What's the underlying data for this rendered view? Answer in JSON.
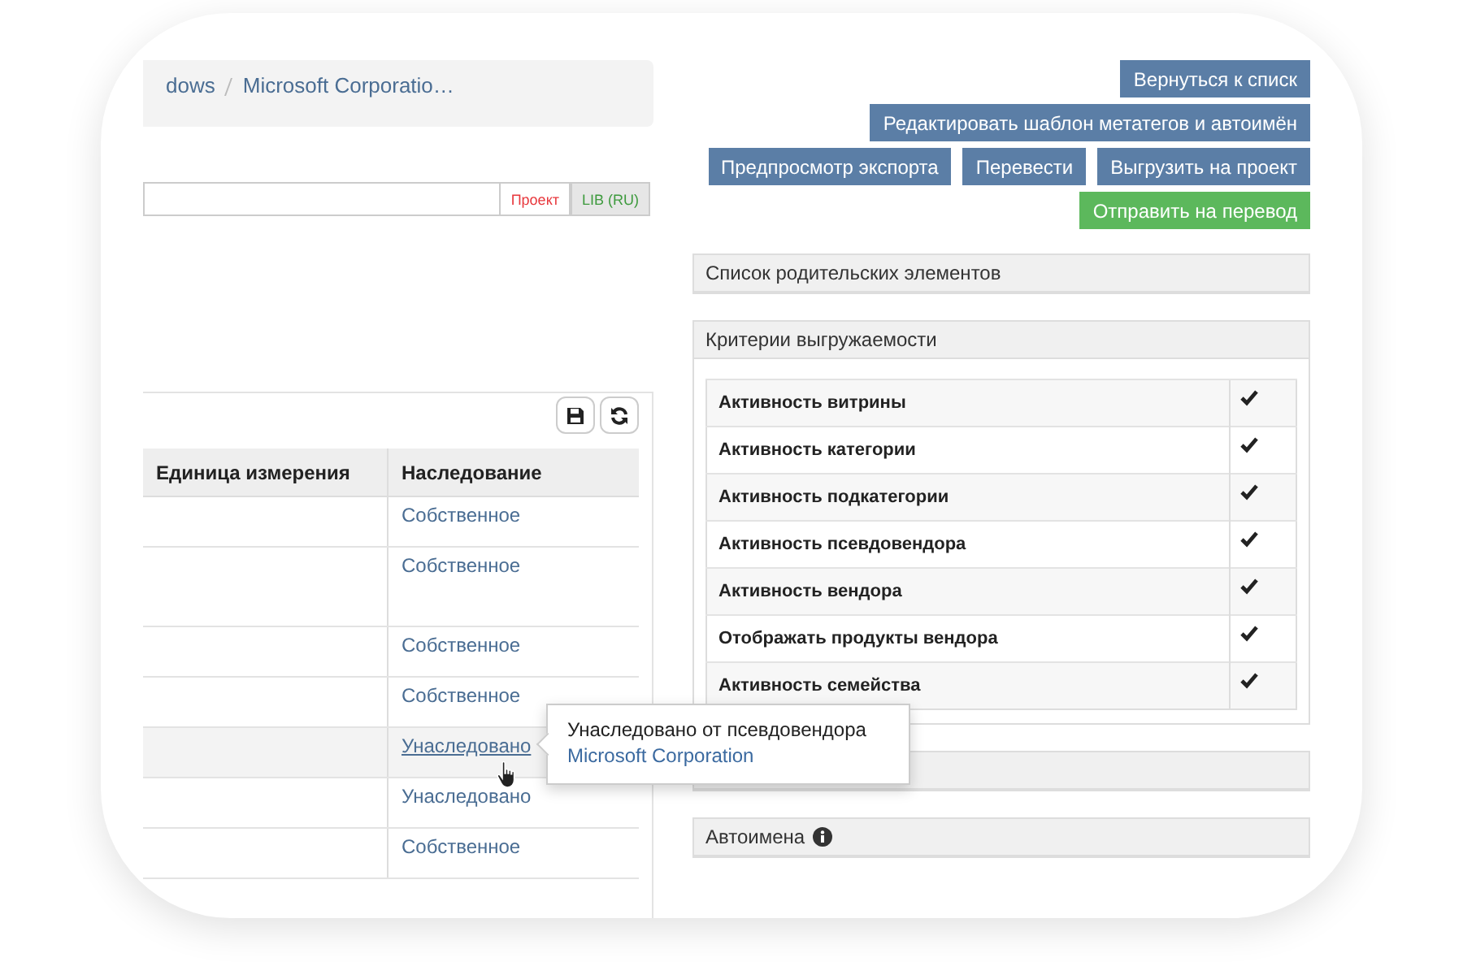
{
  "breadcrumb": [
    {
      "label": "dows"
    },
    {
      "label": "Microsoft Corporatio…"
    }
  ],
  "language_field": {
    "tabs": [
      {
        "label": "Проект",
        "selected": false,
        "color": "#e8383d"
      },
      {
        "label": "LIB (RU)",
        "selected": true,
        "color": "#3d9a3d"
      }
    ]
  },
  "table": {
    "columns": [
      "Единица измерения",
      "Наследование"
    ],
    "rows": [
      {
        "inheritance": "Собственное",
        "hovered": false
      },
      {
        "inheritance": "Собственное",
        "hovered": false
      },
      {
        "inheritance": "Собственное",
        "hovered": false
      },
      {
        "inheritance": "Собственное",
        "hovered": false
      },
      {
        "inheritance": "Унаследовано",
        "hovered": true
      },
      {
        "inheritance": "Унаследовано",
        "hovered": false
      },
      {
        "inheritance": "Собственное",
        "hovered": false
      }
    ]
  },
  "tooltip": {
    "text": "Унаследовано от псевдовендора",
    "link": "Microsoft Corporation"
  },
  "button_rows": [
    [
      {
        "label": "Вернуться к списк",
        "kind": "primary"
      }
    ],
    [
      {
        "label": "Редактировать шаблон метатегов и автоимён",
        "kind": "primary"
      }
    ],
    [
      {
        "label": "Предпросмотр экспорта",
        "kind": "primary"
      },
      {
        "label": "Перевести",
        "kind": "primary"
      },
      {
        "label": "Выгрузить на проект",
        "kind": "primary"
      }
    ],
    [
      {
        "label": "Отправить на перевод",
        "kind": "success"
      }
    ]
  ],
  "panels": [
    {
      "kind": "header",
      "title": "Список родительских элементов"
    },
    {
      "kind": "criteria",
      "title": "Критерии выгружаемости",
      "criteria": [
        {
          "label": "Активность витрины",
          "checked": true
        },
        {
          "label": "Активность категории",
          "checked": true
        },
        {
          "label": "Активность подкатегории",
          "checked": true
        },
        {
          "label": "Активность псевдовендора",
          "checked": true
        },
        {
          "label": "Активность вендора",
          "checked": true
        },
        {
          "label": "Отображать продукты вендора",
          "checked": true
        },
        {
          "label": "Активность семейства",
          "checked": true
        }
      ]
    },
    {
      "kind": "header"
    },
    {
      "kind": "header",
      "title": "Автоимена",
      "info": true
    }
  ]
}
